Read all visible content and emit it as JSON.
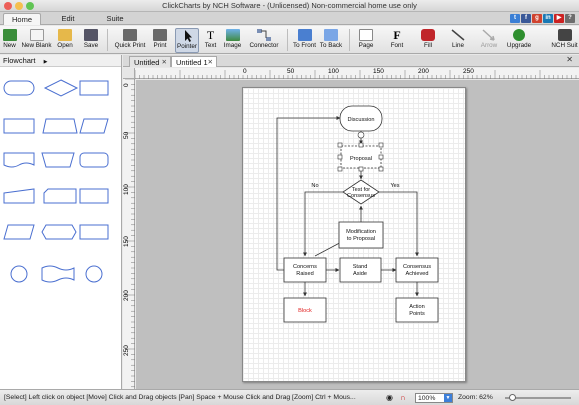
{
  "window": {
    "title": "ClickCharts by NCH Software - (Unlicensed) Non-commercial home use only"
  },
  "menu_tabs": [
    "Home",
    "Edit",
    "Suite"
  ],
  "social_icons": [
    "twitter-icon",
    "facebook-icon",
    "google-icon",
    "linkedin-icon",
    "youtube-icon",
    "help-icon"
  ],
  "toolbar": [
    {
      "id": "new",
      "label": "New",
      "icon": "new-document-icon",
      "color": "#3a8d3a"
    },
    {
      "id": "new-blank",
      "label": "New Blank",
      "icon": "blank-document-icon",
      "color": "#dddddd"
    },
    {
      "id": "open",
      "label": "Open",
      "icon": "folder-icon",
      "color": "#e6b84a"
    },
    {
      "id": "save",
      "label": "Save",
      "icon": "floppy-disk-icon",
      "color": "#555566"
    },
    {
      "id": "quick-print",
      "label": "Quick Print",
      "icon": "printer-icon",
      "color": "#6a6a6a"
    },
    {
      "id": "print",
      "label": "Print",
      "icon": "printer-icon",
      "color": "#6a6a6a"
    },
    {
      "id": "pointer",
      "label": "Pointer",
      "icon": "pointer-arrow-icon",
      "color": "#111111"
    },
    {
      "id": "text",
      "label": "Text",
      "icon": "text-t-icon",
      "color": "#111111"
    },
    {
      "id": "image",
      "label": "Image",
      "icon": "image-icon",
      "color": "#4a8bd6"
    },
    {
      "id": "connector",
      "label": "Connector",
      "icon": "connector-icon",
      "color": "#777777"
    },
    {
      "id": "to-front",
      "label": "To Front",
      "icon": "bring-front-icon",
      "color": "#4a7fd0"
    },
    {
      "id": "to-back",
      "label": "To Back",
      "icon": "send-back-icon",
      "color": "#4a7fd0"
    },
    {
      "id": "page",
      "label": "Page",
      "icon": "page-icon",
      "color": "#7a7a7a"
    },
    {
      "id": "font",
      "label": "Font",
      "icon": "font-f-icon",
      "color": "#111111"
    },
    {
      "id": "fill",
      "label": "Fill",
      "icon": "paint-bucket-icon",
      "color": "#c0262b"
    },
    {
      "id": "line",
      "label": "Line",
      "icon": "line-icon",
      "color": "#555555"
    },
    {
      "id": "arrow",
      "label": "Arrow",
      "icon": "arrow-line-icon",
      "color": "#aaaaaa"
    },
    {
      "id": "upgrade",
      "label": "Upgrade",
      "icon": "upgrade-icon",
      "color": "#2f8f2f"
    },
    {
      "id": "nch-suite",
      "label": "NCH Suit",
      "icon": "nch-suite-icon",
      "color": "#444444"
    }
  ],
  "left_panel": {
    "category": "Flowchart"
  },
  "doc_tabs": [
    {
      "label": "Untitled"
    },
    {
      "label": "Untitled 1"
    }
  ],
  "ruler": {
    "h_labels": [
      "0",
      "50",
      "100",
      "150",
      "200",
      "250"
    ],
    "v_labels": [
      "0",
      "50",
      "100",
      "150",
      "200",
      "250"
    ]
  },
  "diagram": {
    "nodes": {
      "discussion": "Discussion",
      "proposal": "Proposal",
      "test_line1": "Test for",
      "test_line2": "Consensus",
      "modification_line1": "Modification",
      "modification_line2": "to Proposal",
      "concerns_line1": "Concerns",
      "concerns_line2": "Raised",
      "stand_line1": "Stand",
      "stand_line2": "Aside",
      "consensus_line1": "Consensus",
      "consensus_line2": "Achieved",
      "block": "Block",
      "action_line1": "Action",
      "action_line2": "Points"
    },
    "edge_labels": {
      "no": "No",
      "yes": "Yes"
    },
    "block_color": "#e02020"
  },
  "status": {
    "hint": "[Select] Left click on object  [Move] Click and Drag objects  [Pan] Space + Mouse Click and Drag  [Zoom] Ctrl + Mous...",
    "zoom_select": "100%",
    "zoom_text": "Zoom: 62%"
  }
}
